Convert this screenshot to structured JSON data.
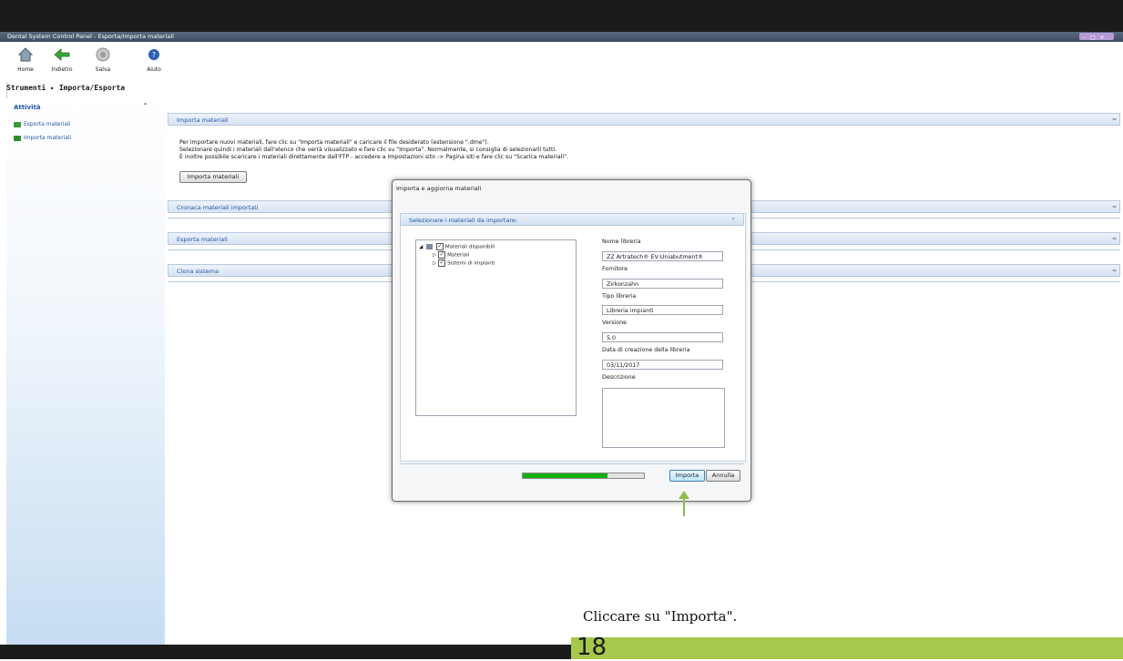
{
  "window": {
    "title": "Dental System Control Panel - Esporta/Importa materiali"
  },
  "toolbar": {
    "buttons": [
      {
        "label": "Home",
        "icon": "home-icon"
      },
      {
        "label": "Indietro",
        "icon": "back-arrow-icon"
      },
      {
        "label": "Salva",
        "icon": "save-icon"
      },
      {
        "label": "Aiuto",
        "icon": "help-icon"
      }
    ]
  },
  "breadcrumb": {
    "root": "Strumenti",
    "separator": "▸",
    "current": "Importa/Esporta"
  },
  "sidebar": {
    "title": "Attività",
    "items": [
      {
        "label": "Esporta materiali",
        "icon": "export-icon"
      },
      {
        "label": "Importa materiali",
        "icon": "import-icon"
      }
    ]
  },
  "main": {
    "sections": [
      {
        "label": "Importa materiali",
        "expanded": true
      },
      {
        "label": "Cronaca materiali importati",
        "expanded": false
      },
      {
        "label": "Esporta materiali",
        "expanded": false
      },
      {
        "label": "Clona sistema",
        "expanded": false
      }
    ],
    "instructions": [
      "Per importare nuovi materiali, fare clic su \"Importa materiali\" e caricare il file desiderato (estensione \".dme\").",
      "Selezionare quindi i materiali dall'elenco che verrà visualizzato e fare clic su \"Importa\". Normalmente, si consiglia di selezionarli tutti.",
      "È inoltre possibile scaricare i materiali direttamente dall'FTP - accedere a Impostazioni sito -> Pagina siti e fare clic su \"Scarica materiali\"."
    ],
    "import_button": "Importa materiali"
  },
  "dialog": {
    "title": "Importa e aggiorna materiali",
    "subheader": "Selezionare i materiali da importare:",
    "tree": [
      {
        "label": "Materiali disponibili",
        "checked": true
      },
      {
        "label": "Materiali",
        "checked": true
      },
      {
        "label": "Sistemi di impianti",
        "checked": true
      }
    ],
    "fields": {
      "nome_label": "Nome libreria",
      "nome_value": "ZZ Artratech® EV-Uniabutment®",
      "fornitore_label": "Fornitore",
      "fornitore_value": "Zirkonzahn",
      "tipo_label": "Tipo libreria",
      "tipo_value": "Libreria impianti",
      "versione_label": "Versione",
      "versione_value": "5.0",
      "data_label": "Data di creazione della libreria",
      "data_value": "03/11/2017",
      "descrizione_label": "Descrizione",
      "descrizione_value": ""
    },
    "progress": 0.7,
    "import_button": "Importa",
    "cancel_button": "Annulla"
  },
  "caption": "Cliccare su \"Importa\".",
  "page_number": "18",
  "colors": {
    "accent_green": "#a6c94b",
    "link_blue": "#2256a8",
    "progress_green": "#0fb10f"
  }
}
